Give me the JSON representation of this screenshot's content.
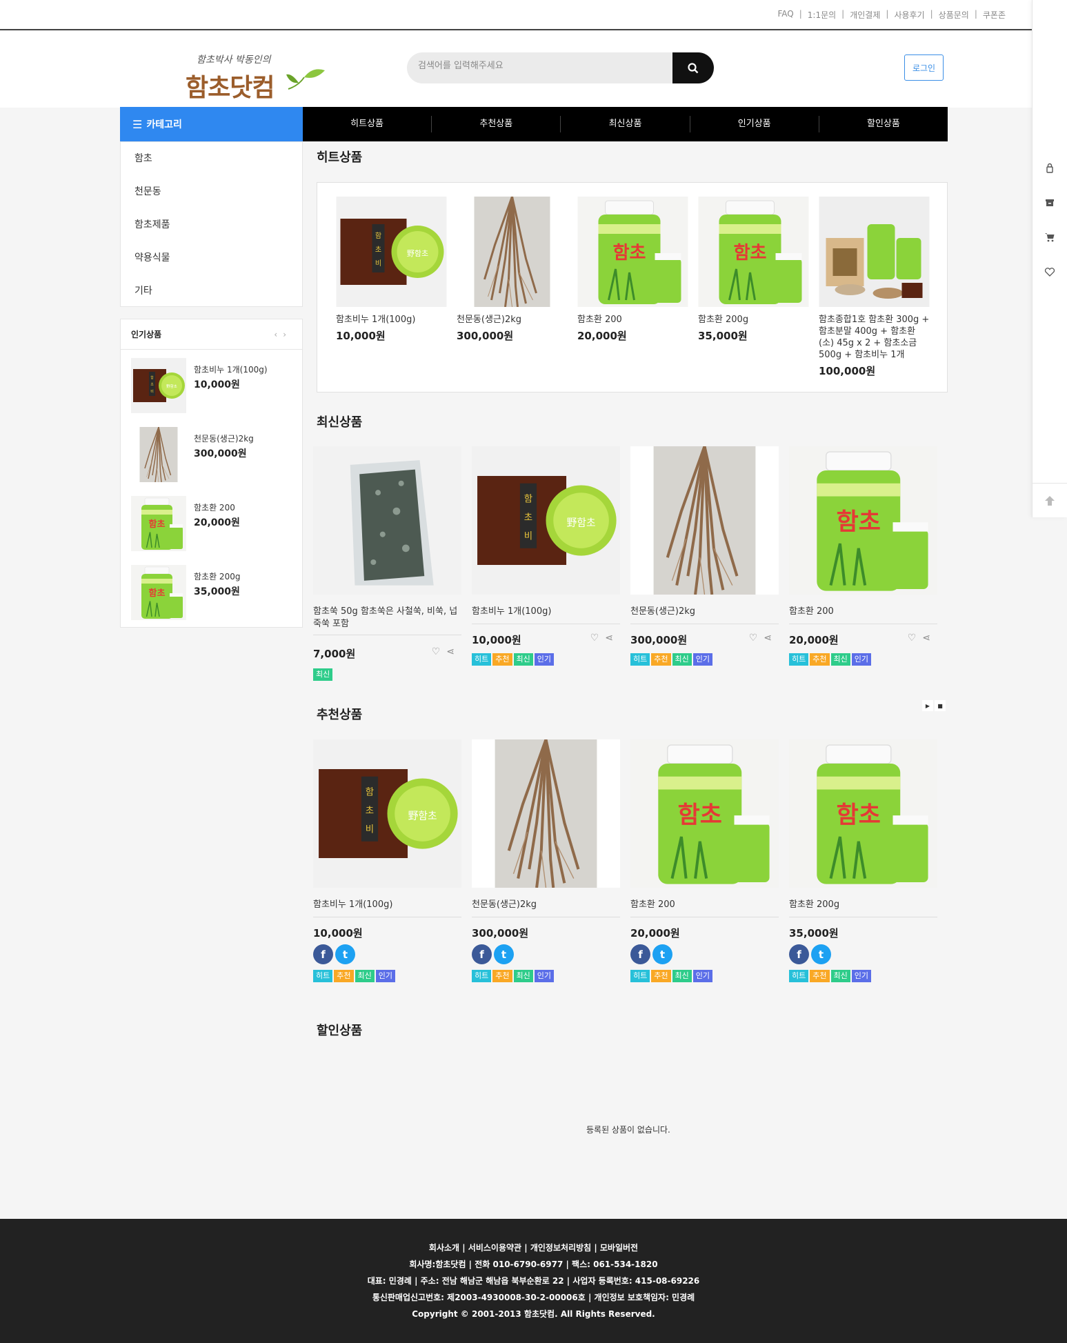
{
  "top_links": [
    "FAQ",
    "1:1문의",
    "개인결제",
    "사용후기",
    "상품문의",
    "쿠폰존"
  ],
  "logo": {
    "subtitle": "함초박사 박동인의",
    "title": "함초닷컴"
  },
  "search": {
    "placeholder": "검색어를 입력해주세요"
  },
  "login_label": "로그인",
  "nav": {
    "category_label": "카테고리",
    "menu": [
      "히트상품",
      "추천상품",
      "최신상품",
      "인기상품",
      "할인상품"
    ]
  },
  "sidebar": {
    "categories": [
      "함초",
      "천문동",
      "함초제품",
      "약용식물",
      "기타"
    ],
    "popular_title": "인기상품",
    "popular_items": [
      {
        "name": "함초비누 1개(100g)",
        "price": "10,000원"
      },
      {
        "name": "천문동(생근)2kg",
        "price": "300,000원"
      },
      {
        "name": "함초환 200",
        "price": "20,000원"
      },
      {
        "name": "함초환 200g",
        "price": "35,000원"
      }
    ]
  },
  "hit_section": {
    "title": "히트상품",
    "items": [
      {
        "name": "함초비누 1개(100g)",
        "price": "10,000원"
      },
      {
        "name": "천문동(생근)2kg",
        "price": "300,000원"
      },
      {
        "name": "함초환 200",
        "price": "20,000원"
      },
      {
        "name": "함초환 200g",
        "price": "35,000원"
      },
      {
        "name": "함초종합1호 함초환 300g + 함초분말 400g + 함초환(소) 45g x 2 + 함초소금 500g + 함초비누 1개",
        "price": "100,000원"
      }
    ]
  },
  "new_section": {
    "title": "최신상품",
    "items": [
      {
        "name": "함초쑥 50g 함초쑥은 사철쑥, 비쑥, 넙죽쑥 포함",
        "price": "7,000원",
        "tags": [
          "최신"
        ]
      },
      {
        "name": "함초비누 1개(100g)",
        "price": "10,000원",
        "tags": [
          "히트",
          "추천",
          "최신",
          "인기"
        ]
      },
      {
        "name": "천문동(생근)2kg",
        "price": "300,000원",
        "tags": [
          "히트",
          "추천",
          "최신",
          "인기"
        ]
      },
      {
        "name": "함초환 200",
        "price": "20,000원",
        "tags": [
          "히트",
          "추천",
          "최신",
          "인기"
        ]
      }
    ]
  },
  "rec_section": {
    "title": "추천상품",
    "items": [
      {
        "name": "함초비누 1개(100g)",
        "price": "10,000원",
        "tags": [
          "히트",
          "추천",
          "최신",
          "인기"
        ]
      },
      {
        "name": "천문동(생근)2kg",
        "price": "300,000원",
        "tags": [
          "히트",
          "추천",
          "최신",
          "인기"
        ]
      },
      {
        "name": "함초환 200",
        "price": "20,000원",
        "tags": [
          "히트",
          "추천",
          "최신",
          "인기"
        ]
      },
      {
        "name": "함초환 200g",
        "price": "35,000원",
        "tags": [
          "히트",
          "추천",
          "최신",
          "인기"
        ]
      }
    ]
  },
  "sale_section": {
    "title": "할인상품",
    "empty": "등록된 상품이 없습니다."
  },
  "tag_labels": {
    "hit": "히트",
    "rec": "추천",
    "new": "최신",
    "pop": "인기"
  },
  "footer": {
    "links": "회사소개 | 서비스이용약관 | 개인정보처리방침 | 모바일버전",
    "line1": "회사명:함초닷컴 | 전화 010-6790-6977 | 팩스: 061-534-1820",
    "line2": "대표: 민경례 | 주소: 전남 해남군 해남읍 북부순환로 22 | 사업자 등록번호: 415-08-69226",
    "line3": "통신판매업신고번호: 제2003-4930008-30-2-00006호 | 개인정보 보호책임자: 민경례",
    "copyright": "Copyright © 2001-2013 함초닷컴. All Rights Reserved."
  },
  "colors": {
    "accent": "#2f88f0",
    "nav_bg": "#000000",
    "footer_bg": "#222222"
  }
}
